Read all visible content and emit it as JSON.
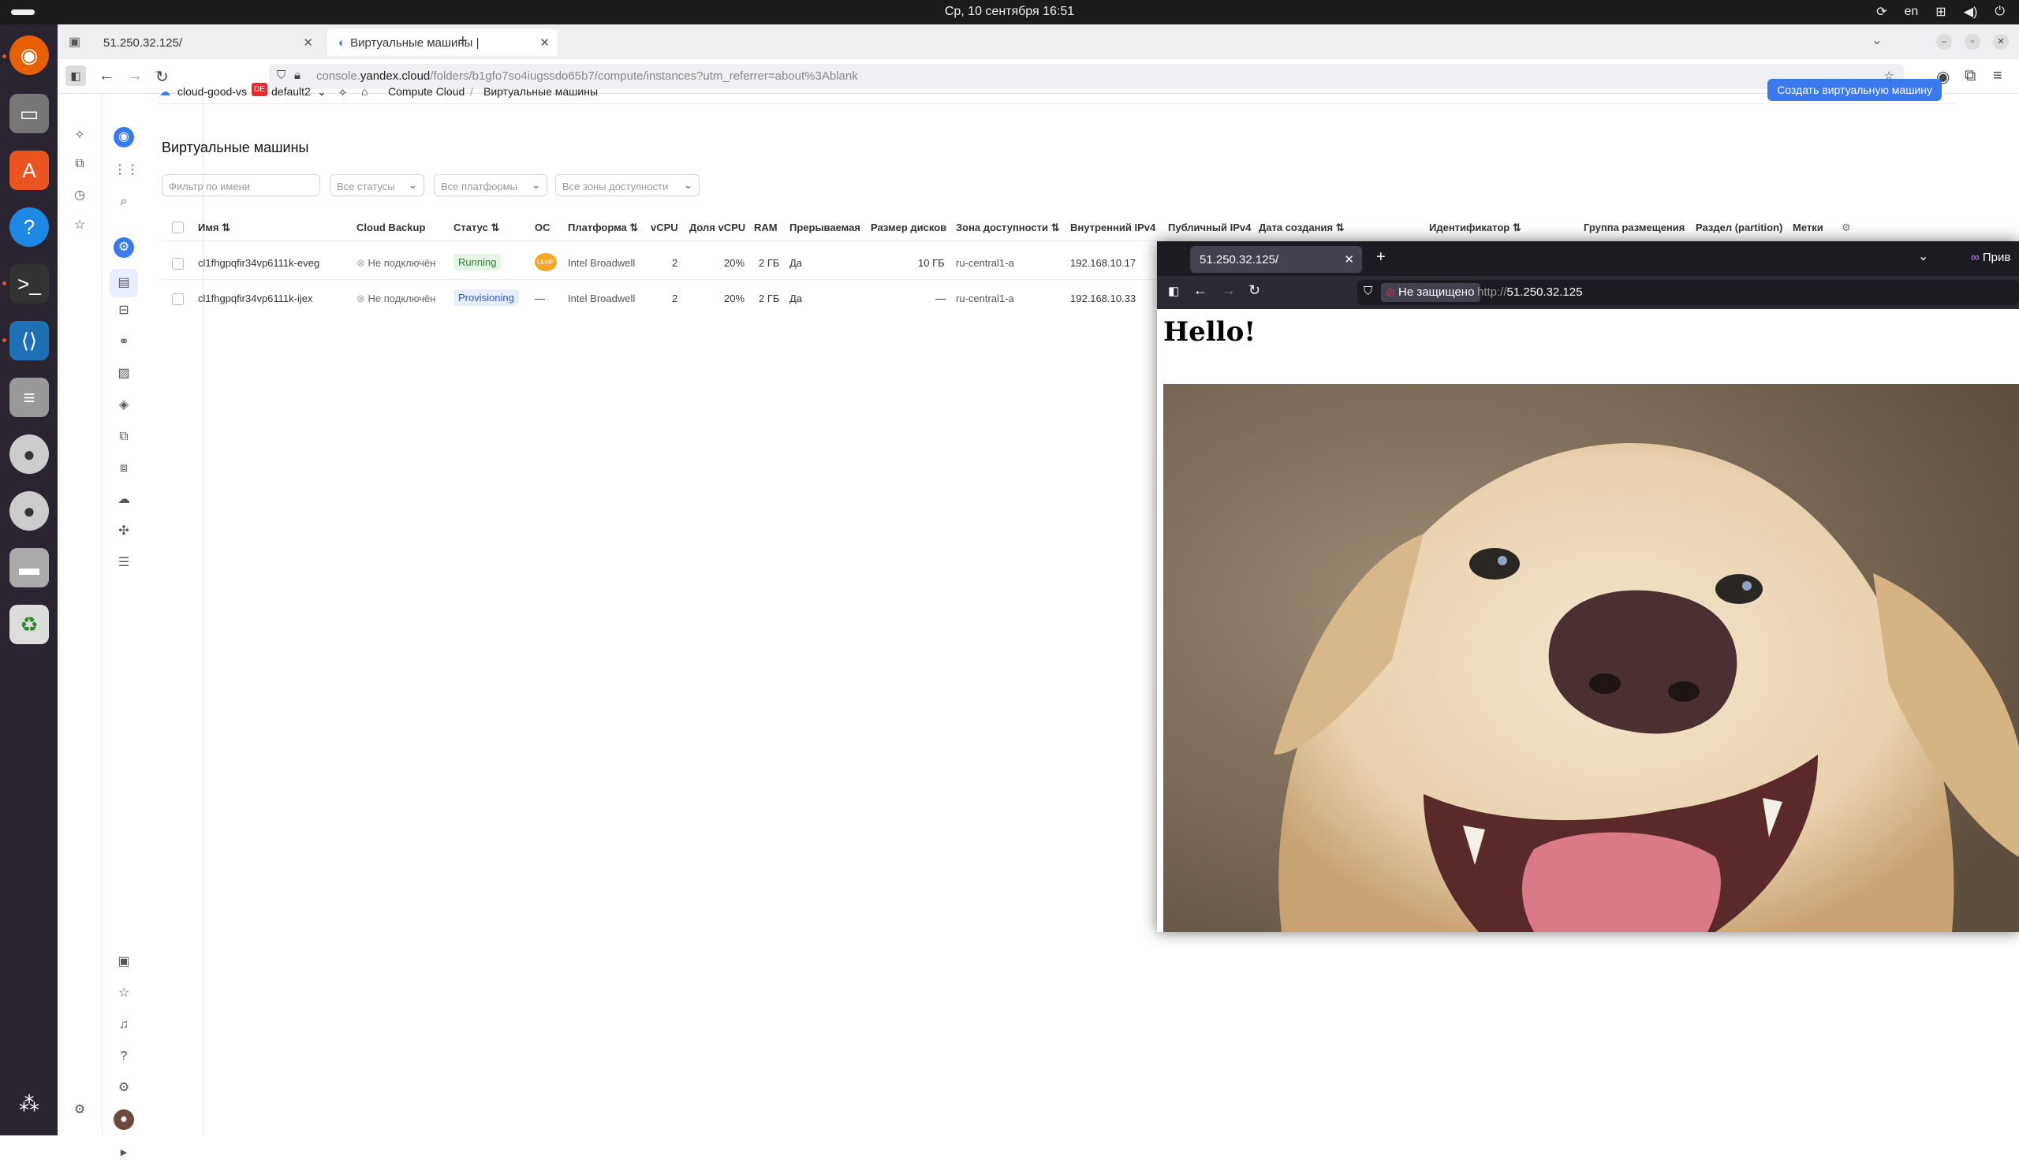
{
  "system_bar": {
    "clock": "Ср, 10 сентября  16:51",
    "lang": "en"
  },
  "browser": {
    "tabs": [
      {
        "label": "51.250.32.125/"
      },
      {
        "label": "Виртуальные машины |"
      }
    ],
    "url_prefix": "console.",
    "url_domain": "yandex.cloud",
    "url_path": "/folders/b1gfo7so4iugssdo65b7/compute/instances?utm_referrer=about%3Ablank"
  },
  "console": {
    "cloud": "cloud-good-vs",
    "folder_badge": "DE",
    "folder": "default2",
    "crumb_service": "Compute Cloud",
    "crumb_sep": "/",
    "crumb_page": "Виртуальные машины",
    "create_button": "Создать виртуальную машину",
    "page_title": "Виртуальные машины",
    "filters": {
      "name_placeholder": "Фильтр по имени",
      "status": "Все статусы",
      "platform": "Все платформы",
      "zone": "Все зоны доступности"
    },
    "columns": [
      "Имя ⇅",
      "Cloud Backup",
      "Статус ⇅",
      "ОС",
      "Платформа ⇅",
      "vCPU",
      "Доля vCPU",
      "RAM",
      "Прерываемая",
      "Размер дисков",
      "Зона доступности ⇅",
      "Внутренний IPv4",
      "Публичный IPv4",
      "Дата создания ⇅",
      "Идентификатор ⇅",
      "Группа размещения",
      "Раздел (partition)",
      "Метки"
    ],
    "rows": [
      {
        "name": "cl1fhgpqfir34vp6111k-eveg",
        "backup": "Не подключён",
        "status": "Running",
        "os": "LEMP",
        "platform": "Intel Broadwell",
        "vcpu": "2",
        "share": "20%",
        "ram": "2 ГБ",
        "preempt": "Да",
        "disk": "10 ГБ",
        "zone": "ru-central1-a",
        "ip": "192.168.10.17"
      },
      {
        "name": "cl1fhgpqfir34vp6111k-ijex",
        "backup": "Не подключён",
        "status": "Provisioning",
        "os": "—",
        "platform": "Intel Broadwell",
        "vcpu": "2",
        "share": "20%",
        "ram": "2 ГБ",
        "preempt": "Да",
        "disk": "—",
        "zone": "ru-central1-a",
        "ip": "192.168.10.33"
      }
    ]
  },
  "inner_browser": {
    "tab": "51.250.32.125/",
    "not_secure": "Не защищено",
    "url_scheme": "http://",
    "url_host": "51.250.32.125",
    "account_label": "Прив",
    "heading": "Hello!"
  },
  "colors": {
    "accent": "#3a79f0",
    "running": "#e6f6e6",
    "provisioning": "#e8eefc",
    "dock": "#2a2430"
  }
}
